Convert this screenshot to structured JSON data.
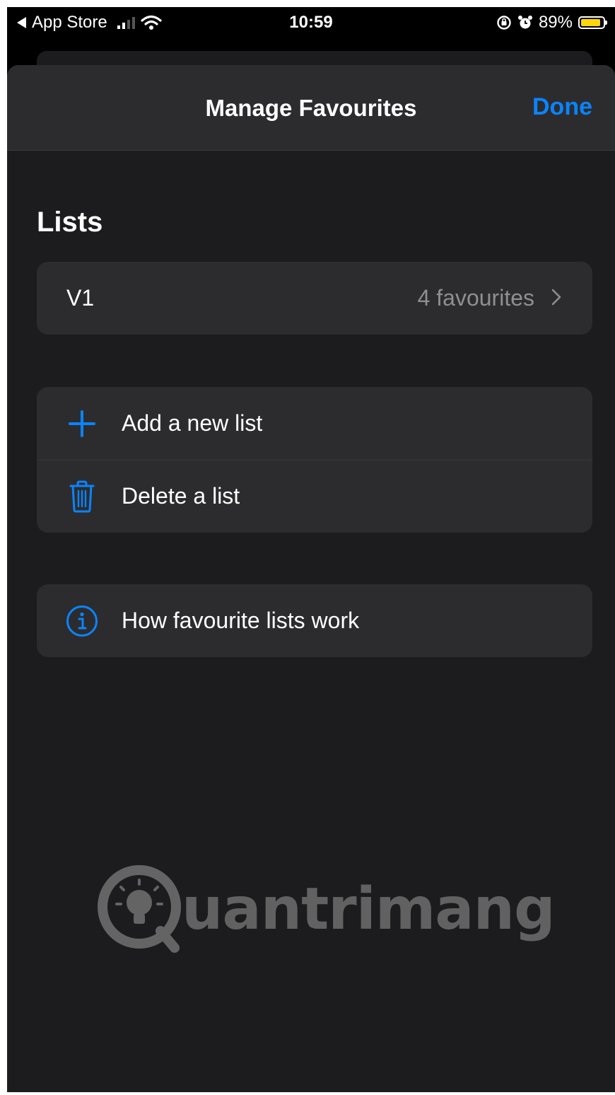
{
  "status_bar": {
    "back_label": "App Store",
    "time": "10:59",
    "battery": "89%",
    "battery_color": "#ffd60a",
    "icons": [
      "back-arrow-icon",
      "cellular-signal-icon",
      "wifi-icon",
      "orientation-lock-icon",
      "alarm-icon",
      "battery-icon"
    ]
  },
  "nav": {
    "title": "Manage Favourites",
    "done_label": "Done"
  },
  "lists_section": {
    "header": "Lists",
    "items": [
      {
        "label": "V1",
        "value": "4 favourites"
      }
    ]
  },
  "actions": [
    {
      "icon": "plus-icon",
      "label": "Add a new list"
    },
    {
      "icon": "trash-icon",
      "label": "Delete a list"
    }
  ],
  "info": {
    "icon": "info-icon",
    "label": "How favourite lists work"
  },
  "watermark": {
    "text": "uantrimang"
  },
  "colors": {
    "accent": "#0a84ff",
    "background": "#1c1c1e",
    "card": "#2c2c2e",
    "secondary_text": "#8e8e93"
  }
}
